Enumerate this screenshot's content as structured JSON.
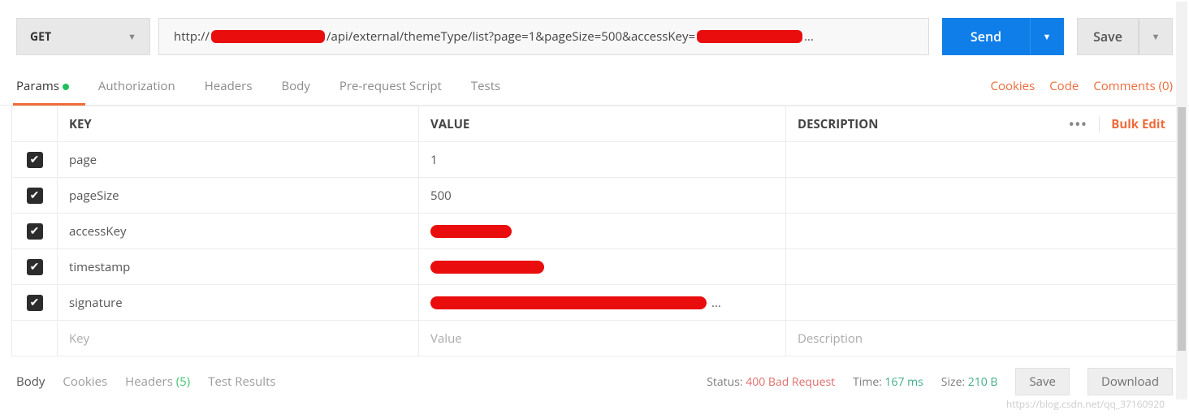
{
  "request": {
    "method": "GET",
    "url_prefix": "http://",
    "url_mid": "/api/external/themeType/list?page=1&pageSize=500&accessKey=",
    "url_suffix": "..."
  },
  "buttons": {
    "send": "Send",
    "save": "Save"
  },
  "tabs": {
    "params": "Params",
    "authorization": "Authorization",
    "headers": "Headers",
    "body": "Body",
    "prerequest": "Pre-request Script",
    "tests": "Tests"
  },
  "links": {
    "cookies": "Cookies",
    "code": "Code",
    "comments": "Comments (0)",
    "bulk_edit": "Bulk Edit"
  },
  "table": {
    "head_key": "KEY",
    "head_value": "VALUE",
    "head_desc": "DESCRIPTION",
    "rows": [
      {
        "checked": true,
        "key": "page",
        "value": "1",
        "redacted": false
      },
      {
        "checked": true,
        "key": "pageSize",
        "value": "500",
        "redacted": false
      },
      {
        "checked": true,
        "key": "accessKey",
        "value": "",
        "redacted": true,
        "rwidth": "s1"
      },
      {
        "checked": true,
        "key": "timestamp",
        "value": "",
        "redacted": true,
        "rwidth": "s2"
      },
      {
        "checked": true,
        "key": "signature",
        "value": "",
        "redacted": true,
        "rwidth": "s3",
        "trail": "..."
      }
    ],
    "placeholder_key": "Key",
    "placeholder_value": "Value",
    "placeholder_desc": "Description"
  },
  "response": {
    "tabs": {
      "body": "Body",
      "cookies": "Cookies",
      "headers": "Headers",
      "headers_count": "(5)",
      "test_results": "Test Results"
    },
    "status_label": "Status:",
    "status_value": "400 Bad Request",
    "time_label": "Time:",
    "time_value": "167 ms",
    "size_label": "Size:",
    "size_value": "210 B",
    "save_btn": "Save",
    "download_btn": "Download"
  },
  "watermark": "https://blog.csdn.net/qq_37160920"
}
